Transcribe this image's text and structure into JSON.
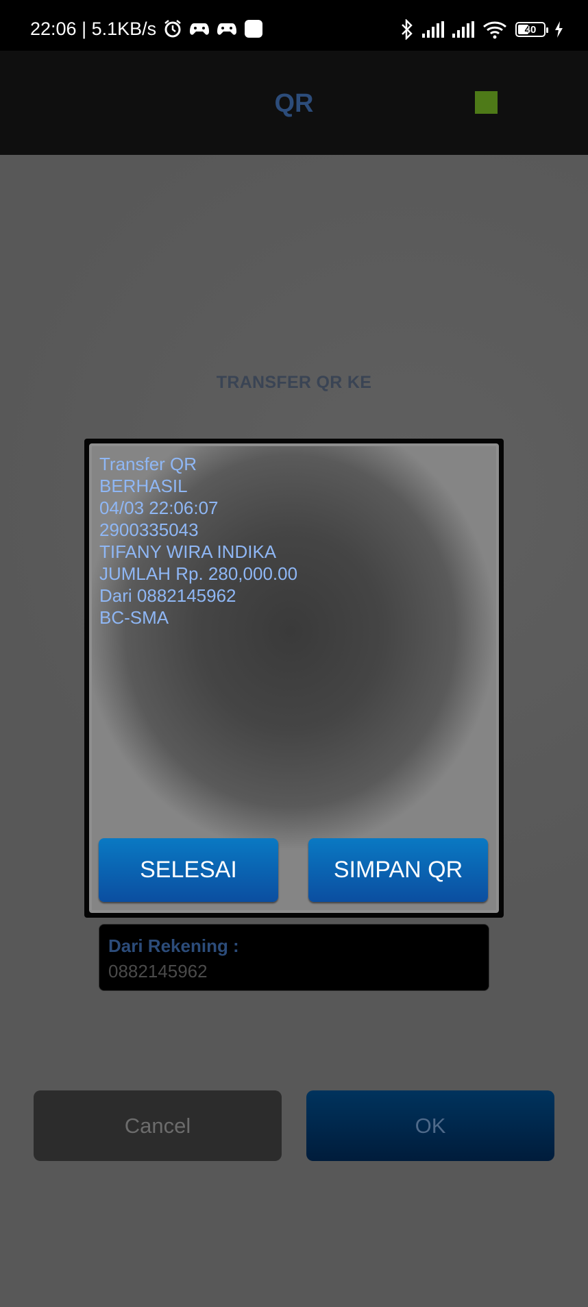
{
  "status_bar": {
    "time_speed": "22:06 | 5.1KB/s",
    "battery_level": "40",
    "icons": [
      "alarm-icon",
      "game-controller-icon",
      "game-controller-icon",
      "app-notification-icon",
      "bluetooth-icon",
      "signal-icon",
      "signal-icon",
      "wifi-icon",
      "battery-icon",
      "charging-icon"
    ]
  },
  "header": {
    "title": "QR",
    "indicator_color": "#4e7a18"
  },
  "section_title": "TRANSFER QR KE",
  "receipt": {
    "lines": [
      "Transfer QR",
      "BERHASIL",
      "04/03 22:06:07",
      "2900335043",
      "TIFANY WIRA INDIKA",
      "JUMLAH Rp. 280,000.00",
      "Dari 0882145962",
      "BC-SMA"
    ],
    "text_color": "#8fb7f5"
  },
  "dialog_buttons": {
    "done_label": "SELESAI",
    "save_label": "SIMPAN QR"
  },
  "from_account": {
    "label": "Dari Rekening :",
    "value": "0882145962"
  },
  "actions": {
    "cancel_label": "Cancel",
    "ok_label": "OK"
  }
}
